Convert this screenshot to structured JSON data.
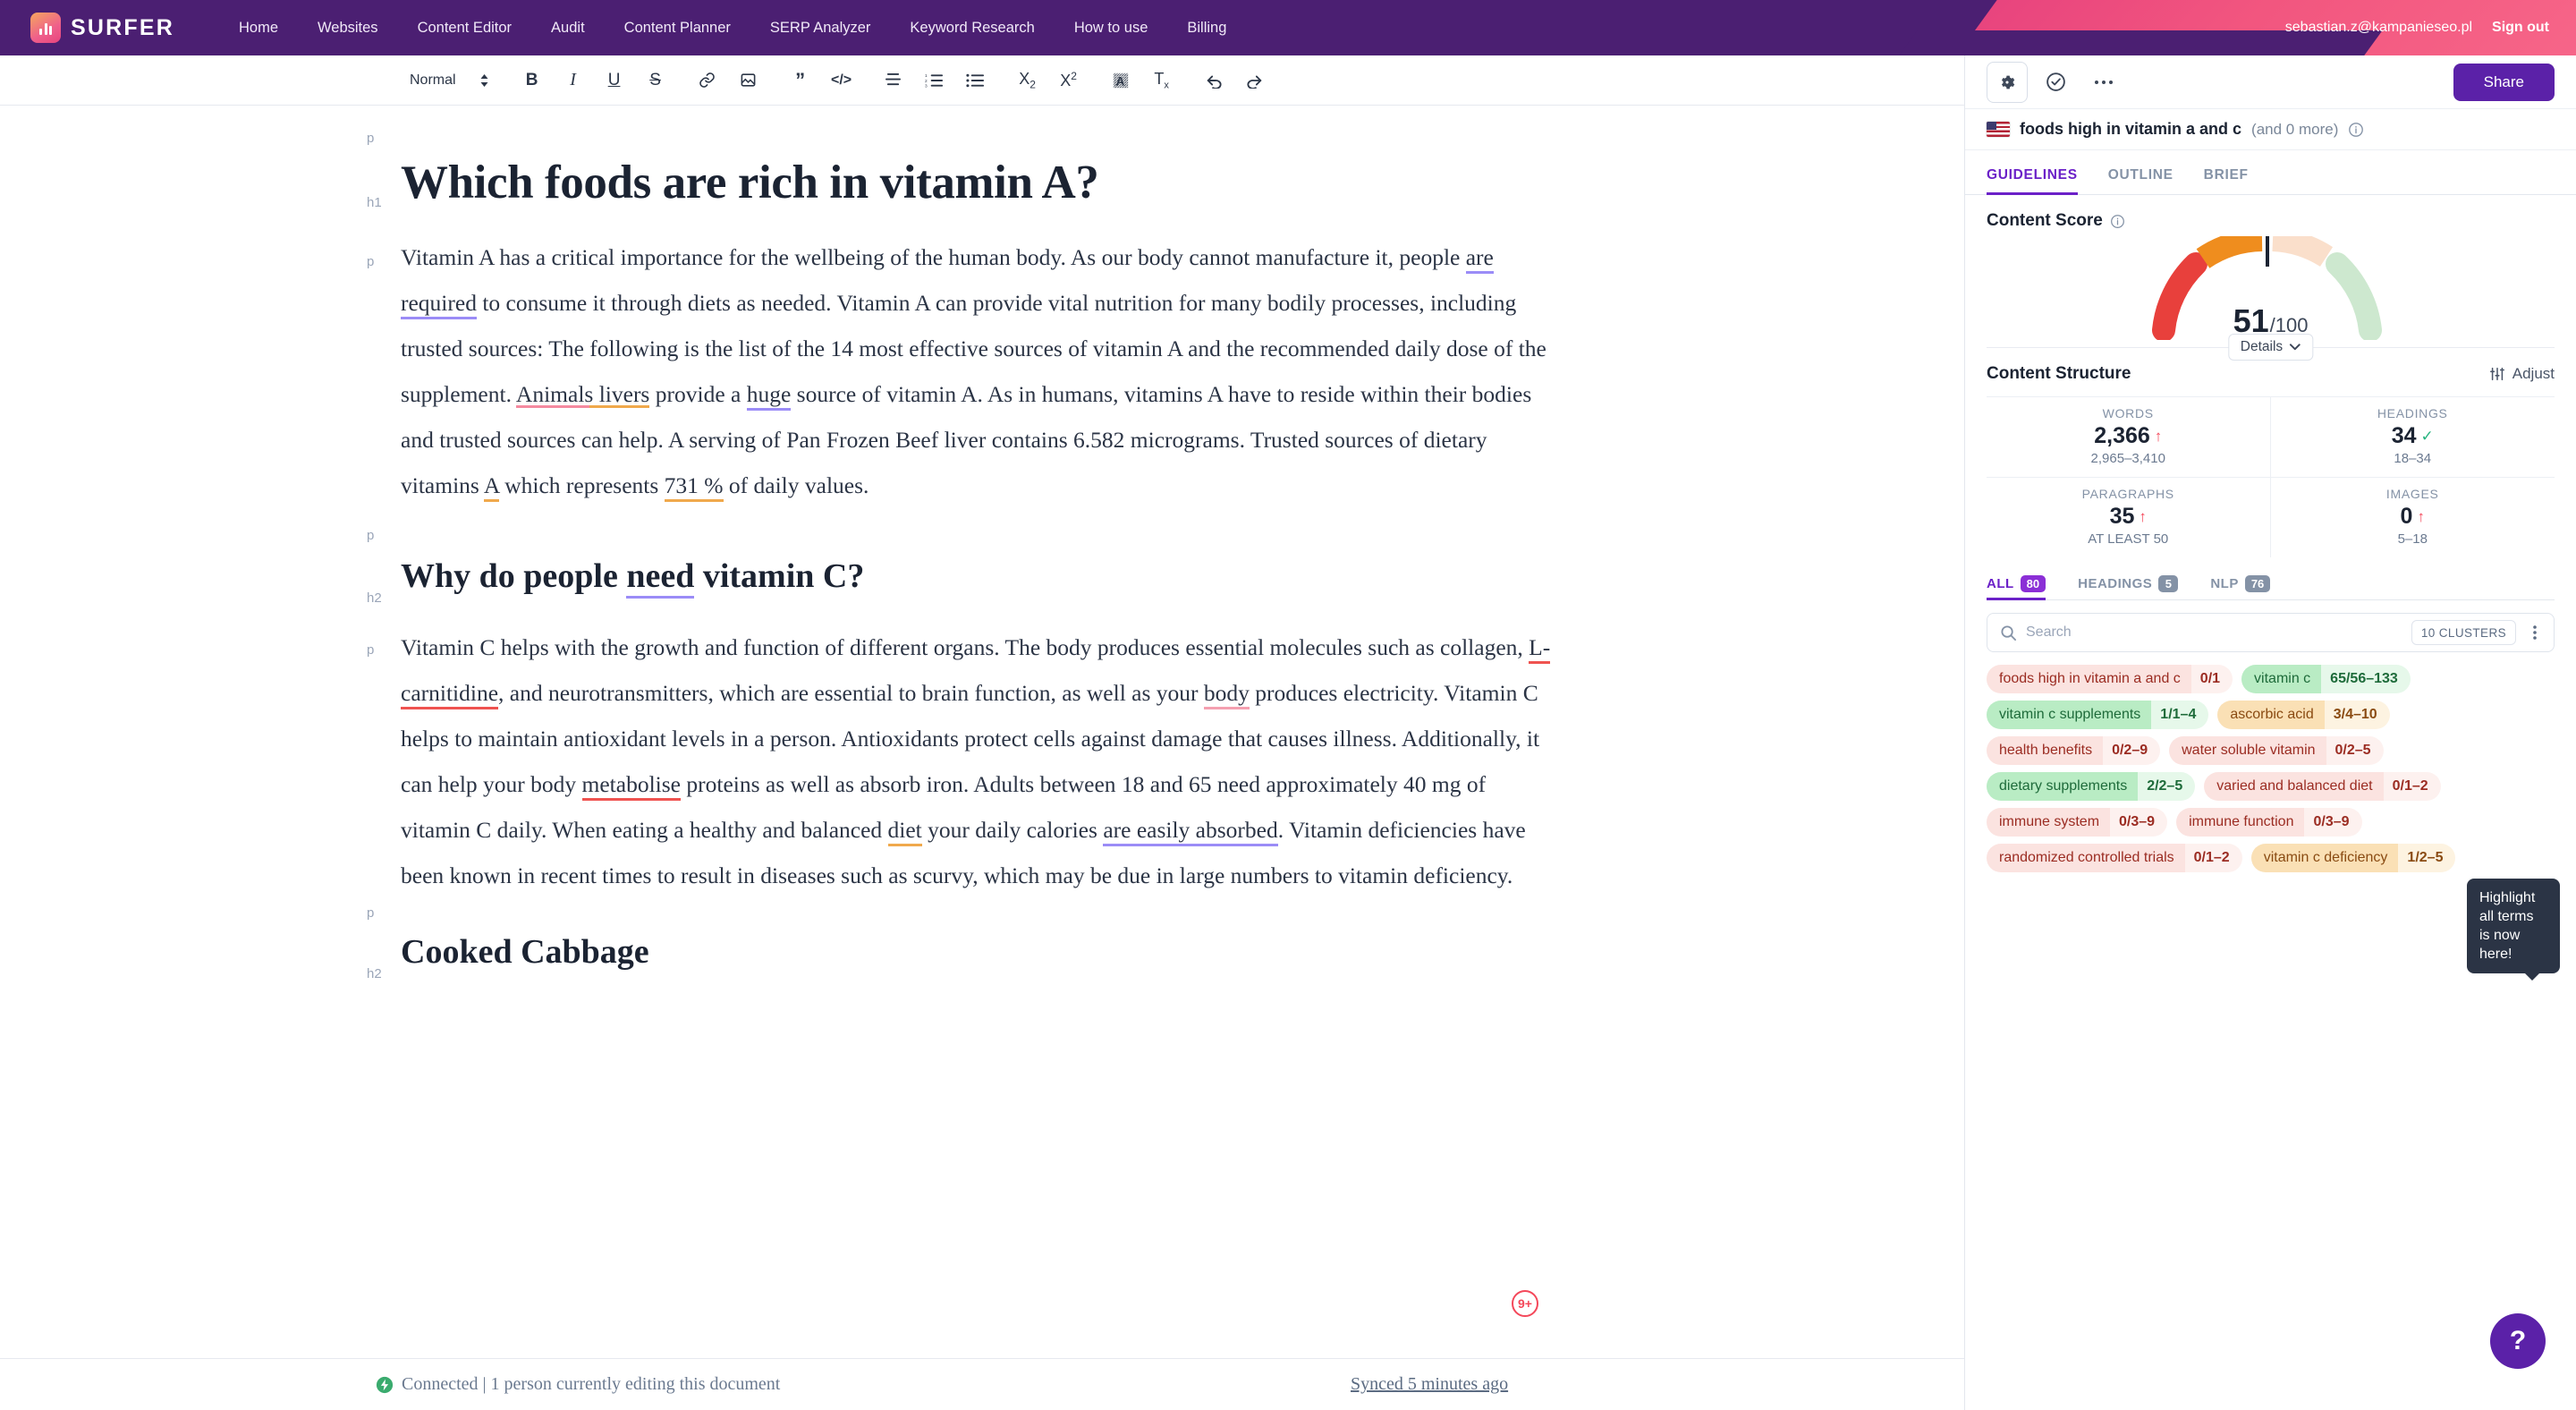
{
  "topnav": {
    "brand": "SURFER",
    "links": [
      "Home",
      "Websites",
      "Content Editor",
      "Audit",
      "Content Planner",
      "SERP Analyzer",
      "Keyword Research",
      "How to use",
      "Billing"
    ],
    "email": "sebastian.z@kampanieseo.pl",
    "signout": "Sign out",
    "brand_purple": "#4b1f72",
    "accent_pink": "#e8447e"
  },
  "toolbar": {
    "style_label": "Normal",
    "icons": [
      "style-dropdown-icon",
      "bold-icon",
      "italic-icon",
      "underline-icon",
      "strikethrough-icon",
      "link-icon",
      "image-icon",
      "blockquote-icon",
      "code-icon",
      "align-icon",
      "ordered-list-icon",
      "bullet-list-icon",
      "subscript-icon",
      "superscript-icon",
      "highlight-icon",
      "clear-format-icon",
      "undo-icon",
      "redo-icon"
    ]
  },
  "document": {
    "blocks": [
      {
        "tag": "p",
        "type": "empty",
        "text": ""
      },
      {
        "tag": "h1",
        "type": "h1",
        "text": "Which foods are rich in vitamin A?"
      },
      {
        "tag": "p",
        "type": "p",
        "id": "para1"
      },
      {
        "tag": "p",
        "type": "empty",
        "text": ""
      },
      {
        "tag": "h2",
        "type": "h2",
        "text": "Why do people need vitamin C?",
        "underline_word": "need"
      },
      {
        "tag": "p",
        "type": "p",
        "id": "para2"
      },
      {
        "tag": "p",
        "type": "empty",
        "text": ""
      },
      {
        "tag": "h2",
        "type": "h2",
        "text": "Cooked Cabbage"
      }
    ],
    "para1_runs": [
      {
        "t": "Vitamin A has a critical importance for the wellbeing of the human body. As our body cannot manufacture it, people ",
        "u": ""
      },
      {
        "t": "are required",
        "u": "purple"
      },
      {
        "t": " to consume it through diets as needed. Vitamin A can provide vital nutrition for many bodily processes, including trusted sources: The following is the list of the 14 most effective sources of vitamin A and the recommended daily dose of the supplement. ",
        "u": ""
      },
      {
        "t": "Animals livers",
        "u": "pinkorange"
      },
      {
        "t": " provide a ",
        "u": ""
      },
      {
        "t": "huge",
        "u": "purple"
      },
      {
        "t": " source of vitamin A. As in humans, vitamins A have to reside within their bodies and trusted sources can help. A serving of Pan Frozen Beef liver contains 6.582 micrograms. Trusted sources of dietary vitamins ",
        "u": ""
      },
      {
        "t": "A",
        "u": "orange"
      },
      {
        "t": " which represents ",
        "u": ""
      },
      {
        "t": "731 %",
        "u": "orange"
      },
      {
        "t": " of daily values.",
        "u": ""
      }
    ],
    "para2_runs": [
      {
        "t": "Vitamin C helps with the growth and function of different organs. The body produces essential molecules such as collagen, ",
        "u": ""
      },
      {
        "t": "L-carnitidine",
        "u": "red"
      },
      {
        "t": ", and neurotransmitters, which are essential to brain function, as well as your ",
        "u": ""
      },
      {
        "t": "body",
        "u": "pink"
      },
      {
        "t": " produces electricity. Vitamin C helps to maintain antioxidant levels in a person. Antioxidants protect cells against damage that causes illness. Additionally, it can help your body ",
        "u": ""
      },
      {
        "t": "metabolise",
        "u": "red"
      },
      {
        "t": " proteins as well as absorb iron. Adults between 18 and 65 need approximately 40 mg of vitamin C daily. When eating a healthy and balanced ",
        "u": ""
      },
      {
        "t": "diet",
        "u": "orange"
      },
      {
        "t": " your daily calories ",
        "u": ""
      },
      {
        "t": "are easily absorbed",
        "u": "purple"
      },
      {
        "t": ". Vitamin deficiencies have ",
        "u": ""
      },
      {
        "t": "been known",
        "u": ""
      },
      {
        "t": " in recent times to result in diseases such as scurvy, which may be due in large numbers to vitamin deficiency.",
        "u": ""
      }
    ],
    "comment_badge": "9+"
  },
  "statusbar": {
    "connected_text": "Connected | 1 person currently editing this document",
    "synced_text": "Synced 5 minutes ago"
  },
  "panel": {
    "buttons": {
      "settings": "gear-icon",
      "check": "check-circle-icon",
      "more": "ellipsis-icon",
      "share_label": "Share"
    },
    "keyword": {
      "title": "foods high in vitamin a and c",
      "more": "(and 0 more)",
      "flag": "us-flag-icon"
    },
    "tabs": [
      {
        "label": "GUIDELINES",
        "active": true
      },
      {
        "label": "OUTLINE",
        "active": false
      },
      {
        "label": "BRIEF",
        "active": false
      }
    ],
    "score": {
      "title": "Content Score",
      "value": "51",
      "denominator": "/100",
      "details_label": "Details"
    },
    "structure": {
      "title": "Content Structure",
      "adjust_label": "Adjust",
      "stats": [
        {
          "label": "WORDS",
          "value": "2,366",
          "status": "up",
          "range": "2,965–3,410"
        },
        {
          "label": "HEADINGS",
          "value": "34",
          "status": "ok",
          "range": "18–34"
        },
        {
          "label": "PARAGRAPHS",
          "value": "35",
          "status": "up",
          "range": "AT LEAST 50"
        },
        {
          "label": "IMAGES",
          "value": "0",
          "status": "up",
          "range": "5–18"
        }
      ]
    },
    "terms_tabs": [
      {
        "label": "ALL",
        "count": "80",
        "active": true
      },
      {
        "label": "HEADINGS",
        "count": "5",
        "active": false
      },
      {
        "label": "NLP",
        "count": "76",
        "active": false
      }
    ],
    "search": {
      "placeholder": "Search",
      "value": "",
      "clusters_label": "10 CLUSTERS"
    },
    "tooltip": "Highlight all terms is now here!",
    "tags": [
      {
        "name": "foods high in vitamin a and c",
        "count": "0/1",
        "color": "red"
      },
      {
        "name": "vitamin c",
        "count": "65/56–133",
        "color": "green"
      },
      {
        "name": "vitamin c supplements",
        "count": "1/1–4",
        "color": "green"
      },
      {
        "name": "ascorbic acid",
        "count": "3/4–10",
        "color": "amber"
      },
      {
        "name": "health benefits",
        "count": "0/2–9",
        "color": "red"
      },
      {
        "name": "water soluble vitamin",
        "count": "0/2–5",
        "color": "red"
      },
      {
        "name": "dietary supplements",
        "count": "2/2–5",
        "color": "green"
      },
      {
        "name": "varied and balanced diet",
        "count": "0/1–2",
        "color": "red"
      },
      {
        "name": "immune system",
        "count": "0/3–9",
        "color": "red"
      },
      {
        "name": "immune function",
        "count": "0/3–9",
        "color": "red"
      },
      {
        "name": "randomized controlled trials",
        "count": "0/1–2",
        "color": "red"
      },
      {
        "name": "vitamin c deficiency",
        "count": "1/2–5",
        "color": "amber"
      }
    ],
    "help_fab": "?"
  }
}
